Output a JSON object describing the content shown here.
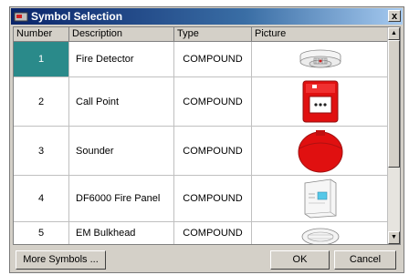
{
  "window": {
    "title": "Symbol Selection",
    "close_label": "x"
  },
  "table": {
    "columns": [
      "Number",
      "Description",
      "Type",
      "Picture"
    ],
    "rows": [
      {
        "number": "1",
        "description": "Fire Detector",
        "type": "COMPOUND",
        "picture": "fire-detector-icon"
      },
      {
        "number": "2",
        "description": "Call Point",
        "type": "COMPOUND",
        "picture": "call-point-icon"
      },
      {
        "number": "3",
        "description": "Sounder",
        "type": "COMPOUND",
        "picture": "sounder-icon"
      },
      {
        "number": "4",
        "description": "DF6000 Fire Panel",
        "type": "COMPOUND",
        "picture": "fire-panel-icon"
      },
      {
        "number": "5",
        "description": "EM Bulkhead",
        "type": "COMPOUND",
        "picture": "bulkhead-icon"
      }
    ],
    "selected_row": 1
  },
  "buttons": {
    "more_symbols": "More Symbols ...",
    "ok": "OK",
    "cancel": "Cancel"
  },
  "colors": {
    "selection": "#2a8a8a",
    "call_point_red": "#e01010",
    "sounder_red": "#e01010"
  }
}
